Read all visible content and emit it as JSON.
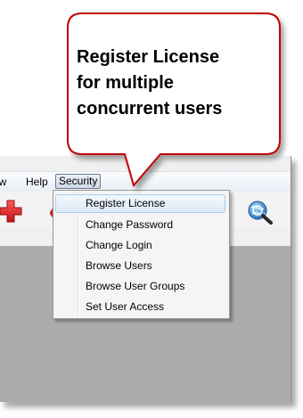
{
  "callout": {
    "lines": [
      "Register License",
      "for multiple",
      "concurrent users"
    ],
    "border_color": "#c00000",
    "fill_color": "#ffffff"
  },
  "menubar": {
    "items": [
      {
        "label": "ow"
      },
      {
        "label": "Help"
      },
      {
        "label": "Security",
        "active": true
      }
    ]
  },
  "toolbar": {
    "icons": [
      "add-icon",
      "partial-toolbar-icon",
      "globe-search-icon"
    ],
    "add_icon_color": "#d21f1f"
  },
  "security_menu": {
    "items": [
      {
        "label": "Register License",
        "highlighted": true
      },
      {
        "label": "Change Password"
      },
      {
        "label": "Change Login"
      },
      {
        "label": "Browse Users"
      },
      {
        "label": "Browse User Groups"
      },
      {
        "label": "Set User Access"
      }
    ]
  },
  "colors": {
    "workspace": "#ababab",
    "menu_highlight": "#ddeaf8"
  }
}
